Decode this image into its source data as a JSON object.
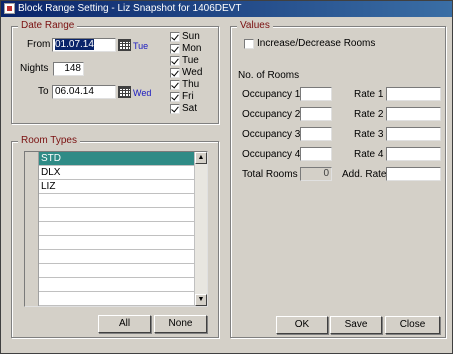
{
  "window": {
    "title": "Block Range Setting - Liz Snapshot for 1406DEVT"
  },
  "date_range": {
    "legend": "Date Range",
    "from_label": "From",
    "from_value": "01.07.14",
    "from_day": "Tue",
    "nights_label": "Nights",
    "nights_value": "148",
    "to_label": "To",
    "to_value": "06.04.14",
    "to_day": "Wed",
    "weekdays": [
      {
        "label": "Sun",
        "checked": true
      },
      {
        "label": "Mon",
        "checked": true
      },
      {
        "label": "Tue",
        "checked": true
      },
      {
        "label": "Wed",
        "checked": true
      },
      {
        "label": "Thu",
        "checked": true
      },
      {
        "label": "Fri",
        "checked": true
      },
      {
        "label": "Sat",
        "checked": true
      }
    ]
  },
  "room_types": {
    "legend": "Room Types",
    "items": [
      "STD",
      "DLX",
      "LIZ"
    ],
    "selected": "STD",
    "all_button": "All",
    "none_button": "None"
  },
  "values": {
    "legend": "Values",
    "increase_decrease_label": "Increase/Decrease Rooms",
    "increase_decrease_checked": false,
    "no_of_rooms_label": "No. of Rooms",
    "occupancy_labels": [
      "Occupancy 1",
      "Occupancy 2",
      "Occupancy 3",
      "Occupancy 4"
    ],
    "rate_labels": [
      "Rate 1",
      "Rate 2",
      "Rate 3",
      "Rate 4"
    ],
    "total_rooms_label": "Total Rooms",
    "total_rooms_value": "0",
    "add_rate_label": "Add. Rate"
  },
  "buttons": {
    "ok": "OK",
    "save": "Save",
    "close": "Close"
  }
}
